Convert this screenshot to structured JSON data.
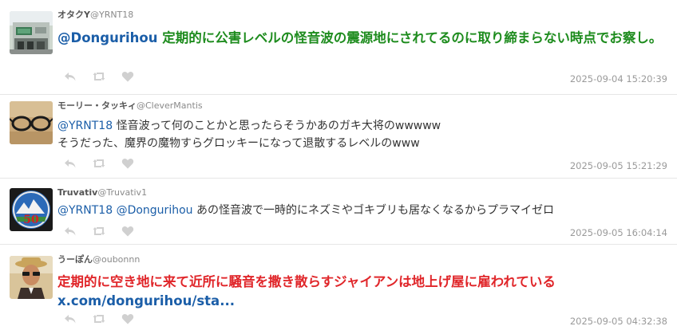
{
  "tweets": [
    {
      "display_name": "オタクY",
      "handle": "@YRNT18",
      "mention": "@Dongurihou",
      "text": "定期的に公害レベルの怪音波の震源地にされてるのに取り締まらない時点でお察し。",
      "timestamp": "2025-09-04 15:20:39"
    },
    {
      "display_name": "モーリー・タッキィ",
      "handle": "@CleverMantis",
      "mention": "@YRNT18",
      "text_line1": " 怪音波って何のことかと思ったらそうかあのガキ大将のwwwww",
      "text_line2": "そうだった、魔界の魔物すらグロッキーになって退散するレベルのwww",
      "timestamp": "2025-09-05 15:21:29"
    },
    {
      "display_name": "Truvativ",
      "handle": "@Truvativ1",
      "mention1": "@YRNT18",
      "mention2": "@Dongurihou",
      "text": " あの怪音波で一時的にネズミやゴキブリも居なくなるからプラマイゼロ",
      "avatar_badge": "50",
      "timestamp": "2025-09-05 16:04:14"
    },
    {
      "display_name": "うーぽん",
      "handle": "@oubonnn",
      "text": "定期的に空き地に来て近所に騒音を撒き散らすジャイアンは地上げ屋に雇われている",
      "link": "x.com/dongurihou/sta...",
      "timestamp": "2025-09-05 04:32:38"
    }
  ],
  "icons": {
    "reply": "reply-icon",
    "retweet": "retweet-icon",
    "like": "heart-icon"
  },
  "colors": {
    "mention": "#1b5ea8",
    "green_text": "#1e8c1e",
    "red_text": "#e0262a",
    "action_icon": "#d0d0d0",
    "timestamp": "#9a9a9a"
  }
}
